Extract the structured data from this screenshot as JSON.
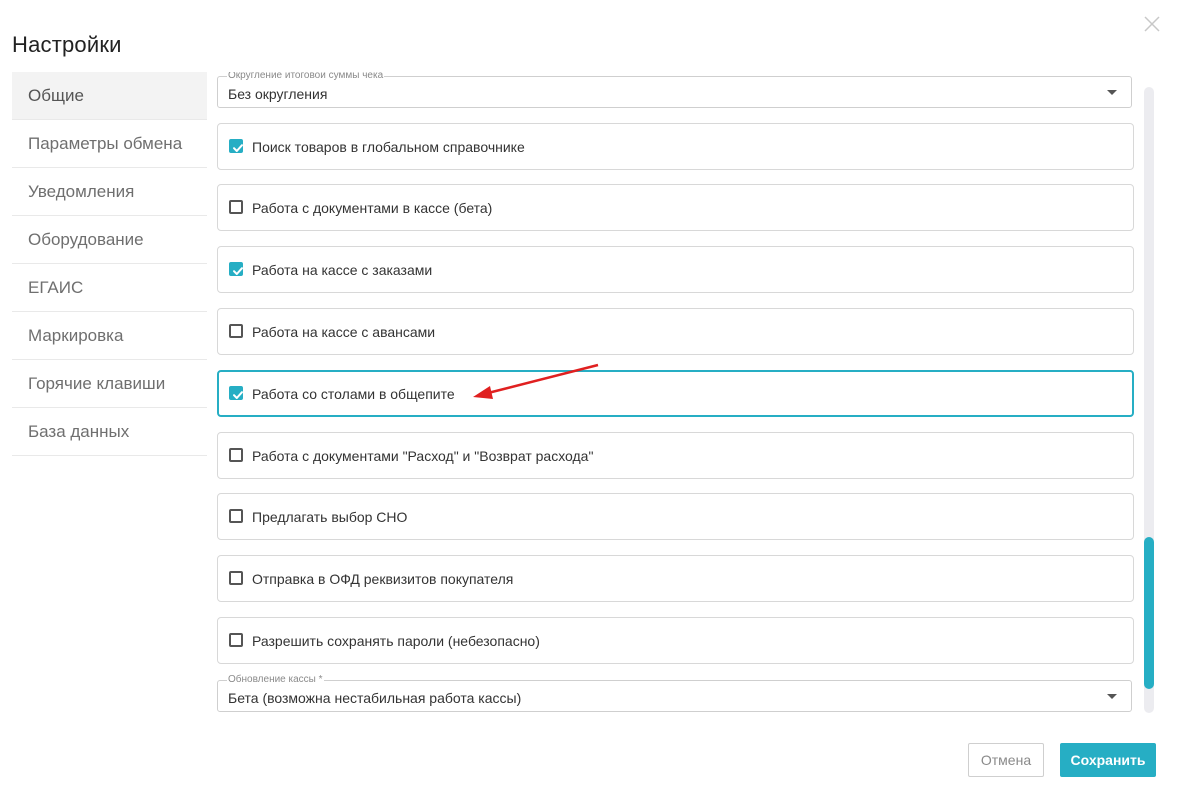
{
  "dialog": {
    "title": "Настройки",
    "close_icon": "close-icon"
  },
  "sidebar": {
    "items": [
      {
        "label": "Общие",
        "active": true
      },
      {
        "label": "Параметры обмена",
        "active": false
      },
      {
        "label": "Уведомления",
        "active": false
      },
      {
        "label": "Оборудование",
        "active": false
      },
      {
        "label": "ЕГАИС",
        "active": false
      },
      {
        "label": "Маркировка",
        "active": false
      },
      {
        "label": "Горячие клавиши",
        "active": false
      },
      {
        "label": "База данных",
        "active": false
      }
    ]
  },
  "settings": {
    "rounding": {
      "label": "Округление итоговой суммы чека",
      "value": "Без округления"
    },
    "options": [
      {
        "label": "Поиск товаров в глобальном справочнике",
        "checked": true
      },
      {
        "label": "Работа с документами в кассе (бета)",
        "checked": false
      },
      {
        "label": "Работа на кассе с заказами",
        "checked": true
      },
      {
        "label": "Работа на кассе с авансами",
        "checked": false
      },
      {
        "label": "Работа со столами в общепите",
        "checked": true,
        "focused": true
      },
      {
        "label": "Работа с документами \"Расход\" и \"Возврат расхода\"",
        "checked": false
      },
      {
        "label": "Предлагать выбор СНО",
        "checked": false
      },
      {
        "label": "Отправка в ОФД реквизитов покупателя",
        "checked": false
      },
      {
        "label": "Разрешить сохранять пароли (небезопасно)",
        "checked": false
      }
    ],
    "update": {
      "label": "Обновление кассы *",
      "value": "Бета (возможна нестабильная работа кассы)"
    }
  },
  "scroll": {
    "position_fraction": 0.95
  },
  "footer": {
    "cancel_label": "Отмена",
    "save_label": "Сохранить"
  },
  "colors": {
    "accent": "#26aec4",
    "annotation_arrow": "#e02020"
  }
}
